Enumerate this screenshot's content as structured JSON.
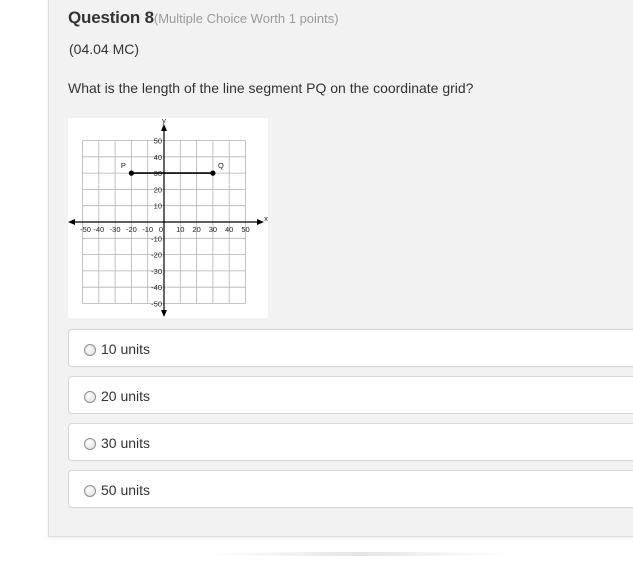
{
  "question": {
    "title": "Question 8",
    "worth": "(Multiple Choice Worth 1 points)",
    "code": "(04.04 MC)",
    "text": "What is the length of the line segment PQ on the coordinate grid?"
  },
  "graph": {
    "x_axis_label": "x",
    "y_axis_label": "y",
    "x_ticks": [
      "-50",
      "-40",
      "-30",
      "-20",
      "-10",
      "0",
      "10",
      "20",
      "30",
      "40",
      "50"
    ],
    "y_ticks_positive": [
      "50",
      "40",
      "30",
      "20",
      "10"
    ],
    "y_ticks_negative": [
      "-10",
      "-20",
      "-30",
      "-40",
      "-50"
    ],
    "point_p": {
      "label": "P",
      "x": -20,
      "y": 30
    },
    "point_q": {
      "label": "Q",
      "x": 30,
      "y": 30
    },
    "range": [
      -50,
      50
    ]
  },
  "choices": [
    {
      "label": "10 units",
      "selected": false
    },
    {
      "label": "20 units",
      "selected": false
    },
    {
      "label": "30 units",
      "selected": false
    },
    {
      "label": "50 units",
      "selected": false
    }
  ],
  "colors": {
    "panel": "#f2f2f2",
    "text": "#333333",
    "muted": "#9a9a9a",
    "grid": "#b3b3b3"
  }
}
